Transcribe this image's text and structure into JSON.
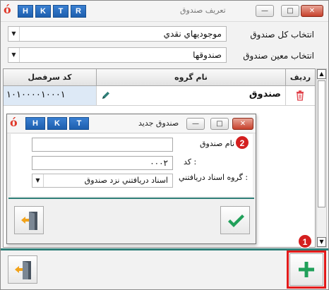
{
  "window": {
    "title": "تعريف صندوق",
    "hotkeys": [
      "H",
      "K",
      "T",
      "R"
    ]
  },
  "filters": {
    "total_label": "انتخاب کل صندوق",
    "total_value": "موجوديهاي نقدي",
    "specific_label": "انتخاب معين صندوق",
    "specific_value": "صندوقها"
  },
  "grid": {
    "columns": [
      "رديف",
      "نام گروه",
      "کد سرفصل"
    ],
    "rows": [
      {
        "group_name": "صندوق",
        "code": "۱۰۱۰۰۰۰۱۰۰۰۱"
      }
    ]
  },
  "dialog": {
    "title": "صندوق جديد",
    "hotkeys": [
      "H",
      "K",
      "T"
    ],
    "name_label": "نام صندوق",
    "name_value": "",
    "code_label": "کد :",
    "code_value": "۰۰۰۲",
    "group_label": "گروه اسناد دريافتني :",
    "group_value": "اسناد دريافتني نزد صندوق"
  },
  "badges": {
    "add": "1",
    "dialog": "2"
  },
  "colors": {
    "accent_teal": "#2f7f78",
    "highlight_red": "#e31b1b",
    "hotkey_blue": "#1d5fae",
    "confirm_green": "#21a05a"
  },
  "icons": {
    "logo": "app-logo-icon",
    "delete": "trash-icon",
    "edit": "pencil-icon",
    "exit": "exit-door-icon",
    "add": "plus-icon",
    "confirm": "check-icon"
  }
}
